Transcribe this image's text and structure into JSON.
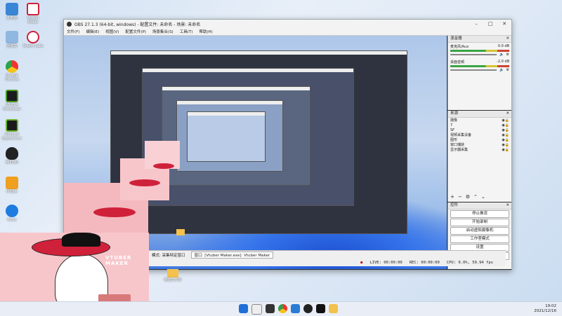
{
  "desktop_icons": [
    {
      "label": "此电脑",
      "icon": "computer-icon",
      "color": "#3a86d6"
    },
    {
      "label": "Vtuber Maker",
      "icon": "vtuber-icon",
      "color": "#d0213a"
    },
    {
      "label": "回收站",
      "icon": "recycle-bin-icon",
      "color": "#8fb7e0"
    },
    {
      "label": "Steam Labs",
      "icon": "steam-labs-icon",
      "color": "#d0213a"
    },
    {
      "label": "Google Chrome",
      "icon": "chrome-icon",
      "color": "#e44"
    },
    {
      "label": "NVIDIA Broadcast",
      "icon": "nvidia-broadcast-icon",
      "color": "#4a9a1a"
    },
    {
      "label": "GeForce Experience",
      "icon": "geforce-icon",
      "color": "#6bb52a"
    },
    {
      "label": "腾讯QQ",
      "icon": "qq-icon",
      "color": "#222"
    },
    {
      "label": "PP助手",
      "icon": "pp-icon",
      "color": "#f0a020"
    },
    {
      "label": "Kuwo",
      "icon": "kuwo-icon",
      "color": "#1e7be0"
    }
  ],
  "obs": {
    "title": "OBS 27.1.3 (64-bit, windows) - 配置文件: 未命名 - 场景: 未命名",
    "menu": [
      "文件(F)",
      "编辑(E)",
      "视图(V)",
      "配置文件(P)",
      "场景集合(S)",
      "工具(T)",
      "帮助(H)"
    ],
    "mixer": {
      "title": "混音器",
      "channels": [
        {
          "name": "麦克风/Aux",
          "db": "0.0 dB"
        },
        {
          "name": "桌面音频",
          "db": "-2.0 dB"
        }
      ]
    },
    "sources": {
      "title": "来源",
      "items": [
        "摄像",
        "7",
        "SF",
        "视频采集设备",
        "图形",
        "窗口捕获",
        "显示器采集"
      ]
    },
    "controls": {
      "title": "控件",
      "buttons": [
        "停止推流",
        "开始录制",
        "启动虚拟摄像机",
        "工作室模式",
        "设置",
        "退出"
      ]
    },
    "mode_label": "模式: 采集特定窗口",
    "window_label": "窗口: [Vtuber Maker.exe]: Vtuber Maker",
    "status": {
      "live": "LIVE: 00:00:00",
      "rec": "REC: 00:00:00",
      "cpu": "CPU: 0.0%, 59.94 fps"
    }
  },
  "cam_overlay": {
    "name": "VTUBER MAKER"
  },
  "desktop_folder": "新建文件夹",
  "taskbar": {
    "time": "19:02",
    "date": "2021/12/16"
  },
  "colors": {
    "accent": "#3473ea",
    "cam_bg": "#f7c6cb",
    "hat": "#d0213a"
  }
}
